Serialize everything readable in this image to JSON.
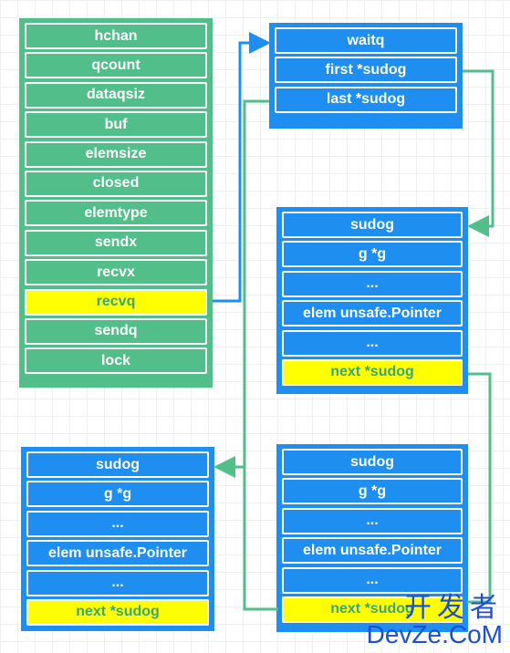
{
  "hchan": {
    "rows": [
      "hchan",
      "qcount",
      "dataqsiz",
      "buf",
      "elemsize",
      "closed",
      "elemtype",
      "sendx",
      "recvx",
      "recvq",
      "sendq",
      "lock"
    ],
    "highlight": "recvq"
  },
  "waitq": {
    "rows": [
      "waitq",
      "first *sudog",
      "last *sudog"
    ]
  },
  "sudog_a": {
    "rows": [
      "sudog",
      "g *g",
      "...",
      "elem unsafe.Pointer",
      "...",
      "next *sudog"
    ]
  },
  "sudog_b": {
    "rows": [
      "sudog",
      "g *g",
      "...",
      "elem unsafe.Pointer",
      "...",
      "next *sudog"
    ]
  },
  "sudog_c": {
    "rows": [
      "sudog",
      "g *g",
      "...",
      "elem unsafe.Pointer",
      "...",
      "next *sudog"
    ]
  },
  "watermark": {
    "cn": "开发者",
    "en": "DevZe.CoM"
  },
  "colors": {
    "green": "#52bf8a",
    "blue": "#1e8ff0",
    "highlight": "#ffff00"
  }
}
